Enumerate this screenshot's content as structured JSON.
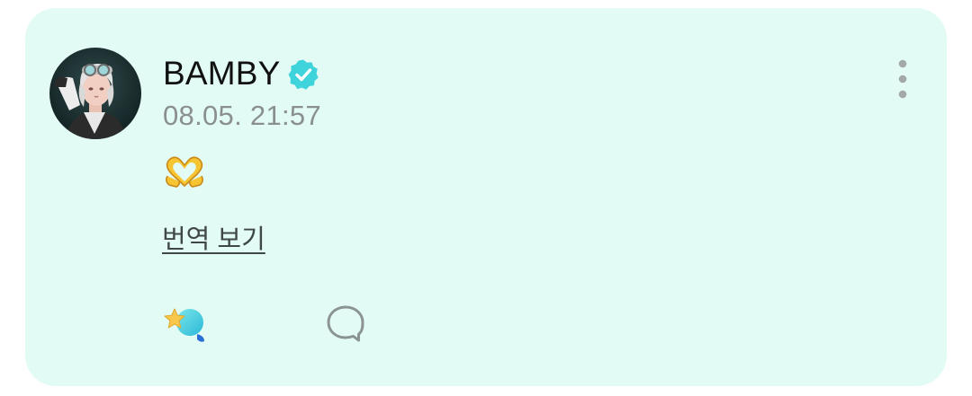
{
  "post": {
    "author": {
      "name": "BAMBY",
      "verified": true,
      "avatar_icon": "artist-avatar"
    },
    "timestamp": "08.05. 21:57",
    "content_emoji": "heart-hands-emoji",
    "translate_label": "번역 보기",
    "actions": {
      "like_icon": "cheer-star-icon",
      "comment_icon": "comment-bubble-icon"
    },
    "menu_icon": "more-vertical-icon"
  },
  "colors": {
    "card_background": "#e3fbf5",
    "verified_badge": "#3fd3db",
    "timestamp": "#8a8f8f",
    "link": "#3f4747",
    "icon_gray": "#8b9494"
  }
}
